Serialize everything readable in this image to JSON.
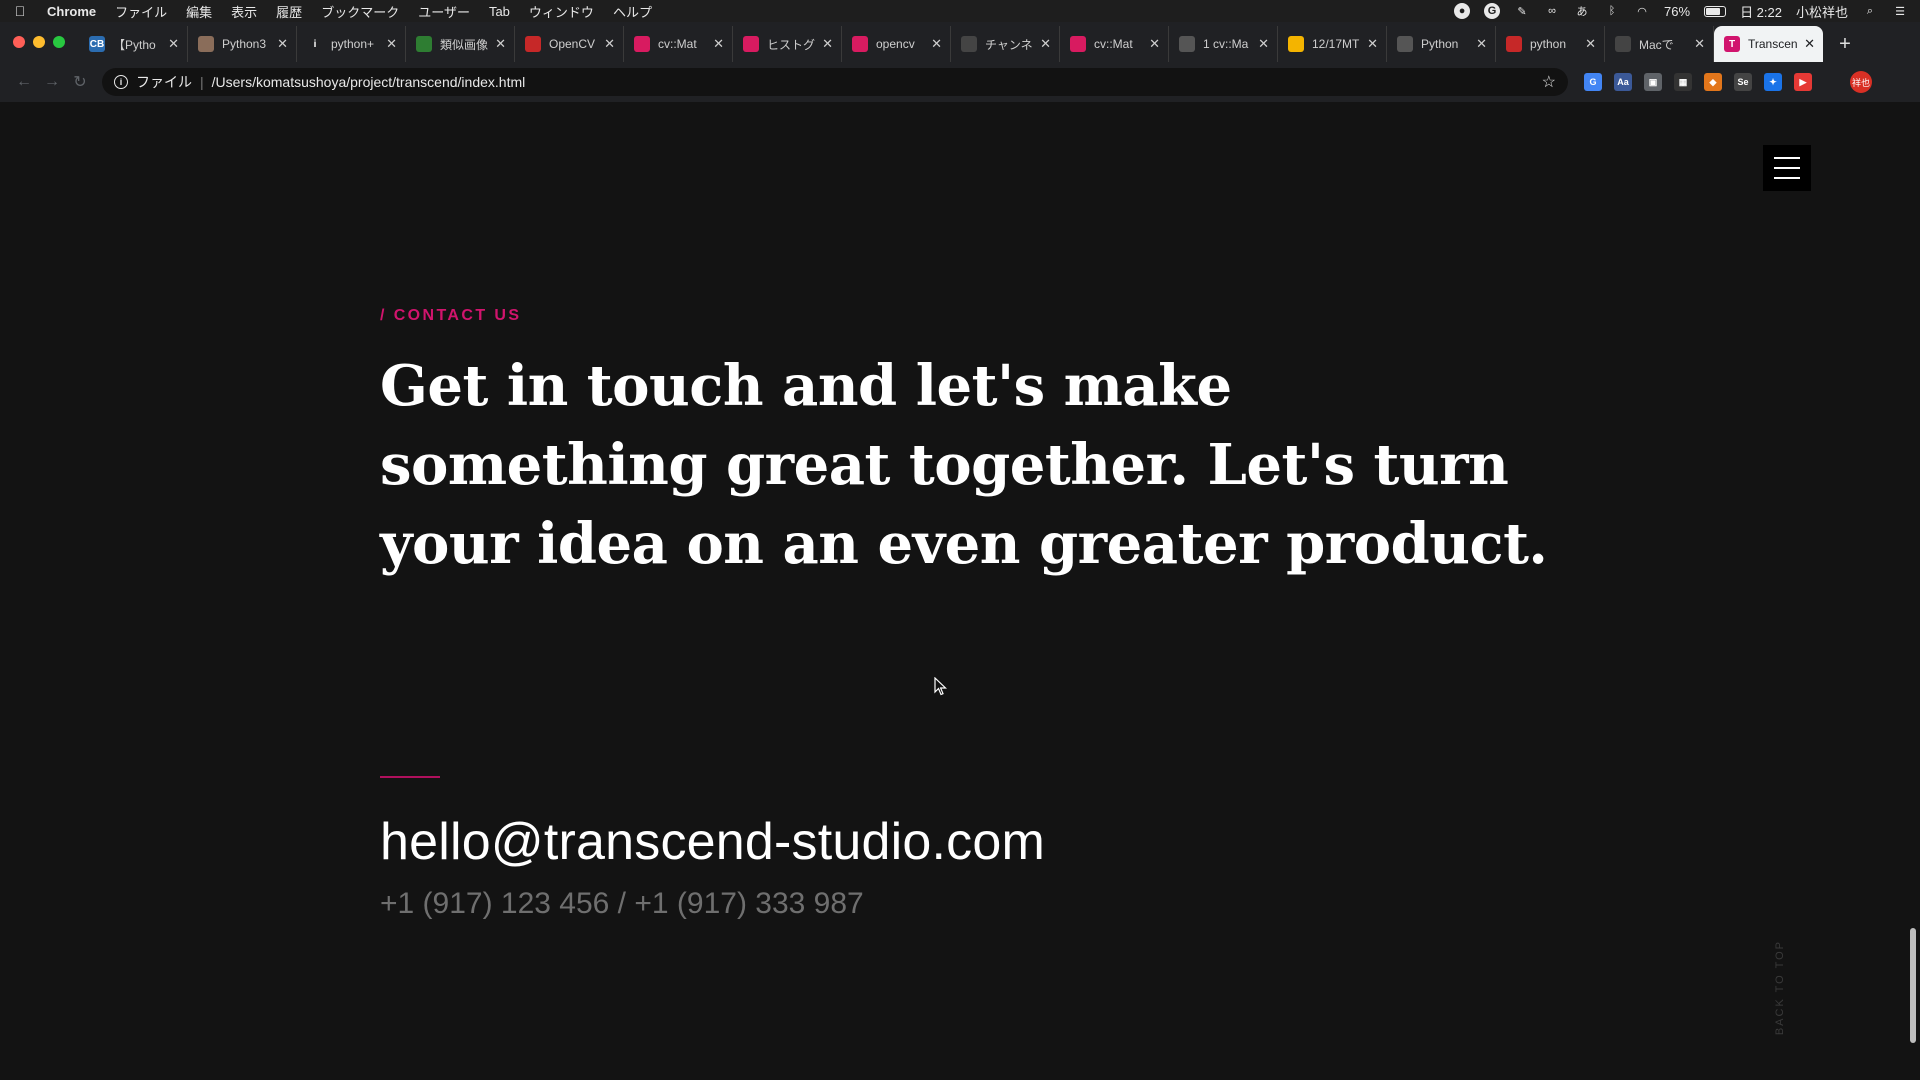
{
  "menubar": {
    "app_name": "Chrome",
    "menus": [
      "ファイル",
      "編集",
      "表示",
      "履歴",
      "ブックマーク",
      "ユーザー",
      "Tab",
      "ウィンドウ",
      "ヘルプ"
    ],
    "battery": "76%",
    "clock": "日 2:22",
    "user": "小松祥也"
  },
  "tabs": [
    {
      "title": "【Pytho",
      "favicon": "python-doc-icon",
      "color": "#2b6cb0",
      "glyph": "CB"
    },
    {
      "title": "Python3",
      "favicon": "avatar-icon",
      "color": "#8a6d5a",
      "glyph": ""
    },
    {
      "title": "python+",
      "favicon": "info-icon",
      "color": "#202124",
      "glyph": "i"
    },
    {
      "title": "類似画像",
      "favicon": "green-circle-icon",
      "color": "#2e7d32",
      "glyph": ""
    },
    {
      "title": "OpenCV",
      "favicon": "opencv-icon",
      "color": "#c62828",
      "glyph": ""
    },
    {
      "title": "cv::Mat",
      "favicon": "qiita-icon",
      "color": "#d81b60",
      "glyph": ""
    },
    {
      "title": "ヒストグ",
      "favicon": "qiita-icon",
      "color": "#d81b60",
      "glyph": ""
    },
    {
      "title": "opencv",
      "favicon": "qiita-icon",
      "color": "#d81b60",
      "glyph": ""
    },
    {
      "title": "チャンネ",
      "favicon": "bird-icon",
      "color": "#444",
      "glyph": ""
    },
    {
      "title": "cv::Mat",
      "favicon": "qiita-icon",
      "color": "#d81b60",
      "glyph": ""
    },
    {
      "title": "1 cv::Ma",
      "favicon": "globe-icon",
      "color": "#555",
      "glyph": ""
    },
    {
      "title": "12/17MT",
      "favicon": "slides-icon",
      "color": "#f4b400",
      "glyph": ""
    },
    {
      "title": "Python",
      "favicon": "globe-icon",
      "color": "#555",
      "glyph": ""
    },
    {
      "title": "python",
      "favicon": "doc-icon",
      "color": "#c62828",
      "glyph": ""
    },
    {
      "title": "Macで",
      "favicon": "apple-icon",
      "color": "#444",
      "glyph": ""
    },
    {
      "title": "Transcen",
      "favicon": "transcend-icon",
      "color": "#d1146d",
      "glyph": "T",
      "active": true
    }
  ],
  "omnibox": {
    "scheme_label": "ファイル",
    "url": "/Users/komatsushoya/project/transcend/index.html"
  },
  "page": {
    "eyebrow": "/ CONTACT US",
    "headline": "Get in touch and let's make something great together. Let's turn your idea on an even greater product.",
    "email": "hello@transcend-studio.com",
    "phones": "+1 (917) 123 456 / +1 (917) 333 987",
    "back_to_top": "BACK TO TOP"
  },
  "colors": {
    "background": "#131313",
    "accent": "#d1146d"
  }
}
